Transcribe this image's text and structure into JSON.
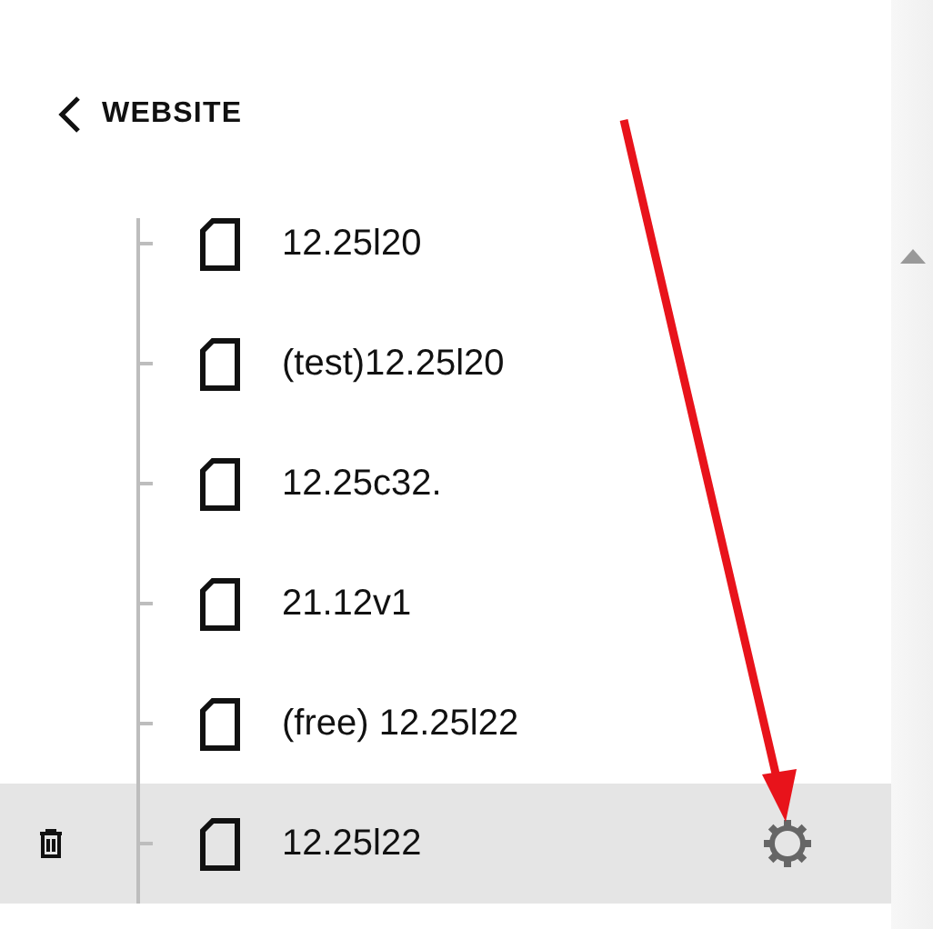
{
  "header": {
    "back_label": "WEBSITE"
  },
  "tree": {
    "items": [
      {
        "name": "12.25l20",
        "selected": false
      },
      {
        "name": "(test)12.25l20",
        "selected": false
      },
      {
        "name": "12.25c32.",
        "selected": false
      },
      {
        "name": "21.12v1",
        "selected": false
      },
      {
        "name": "(free) 12.25l22",
        "selected": false
      },
      {
        "name": "12.25l22",
        "selected": true
      }
    ]
  }
}
